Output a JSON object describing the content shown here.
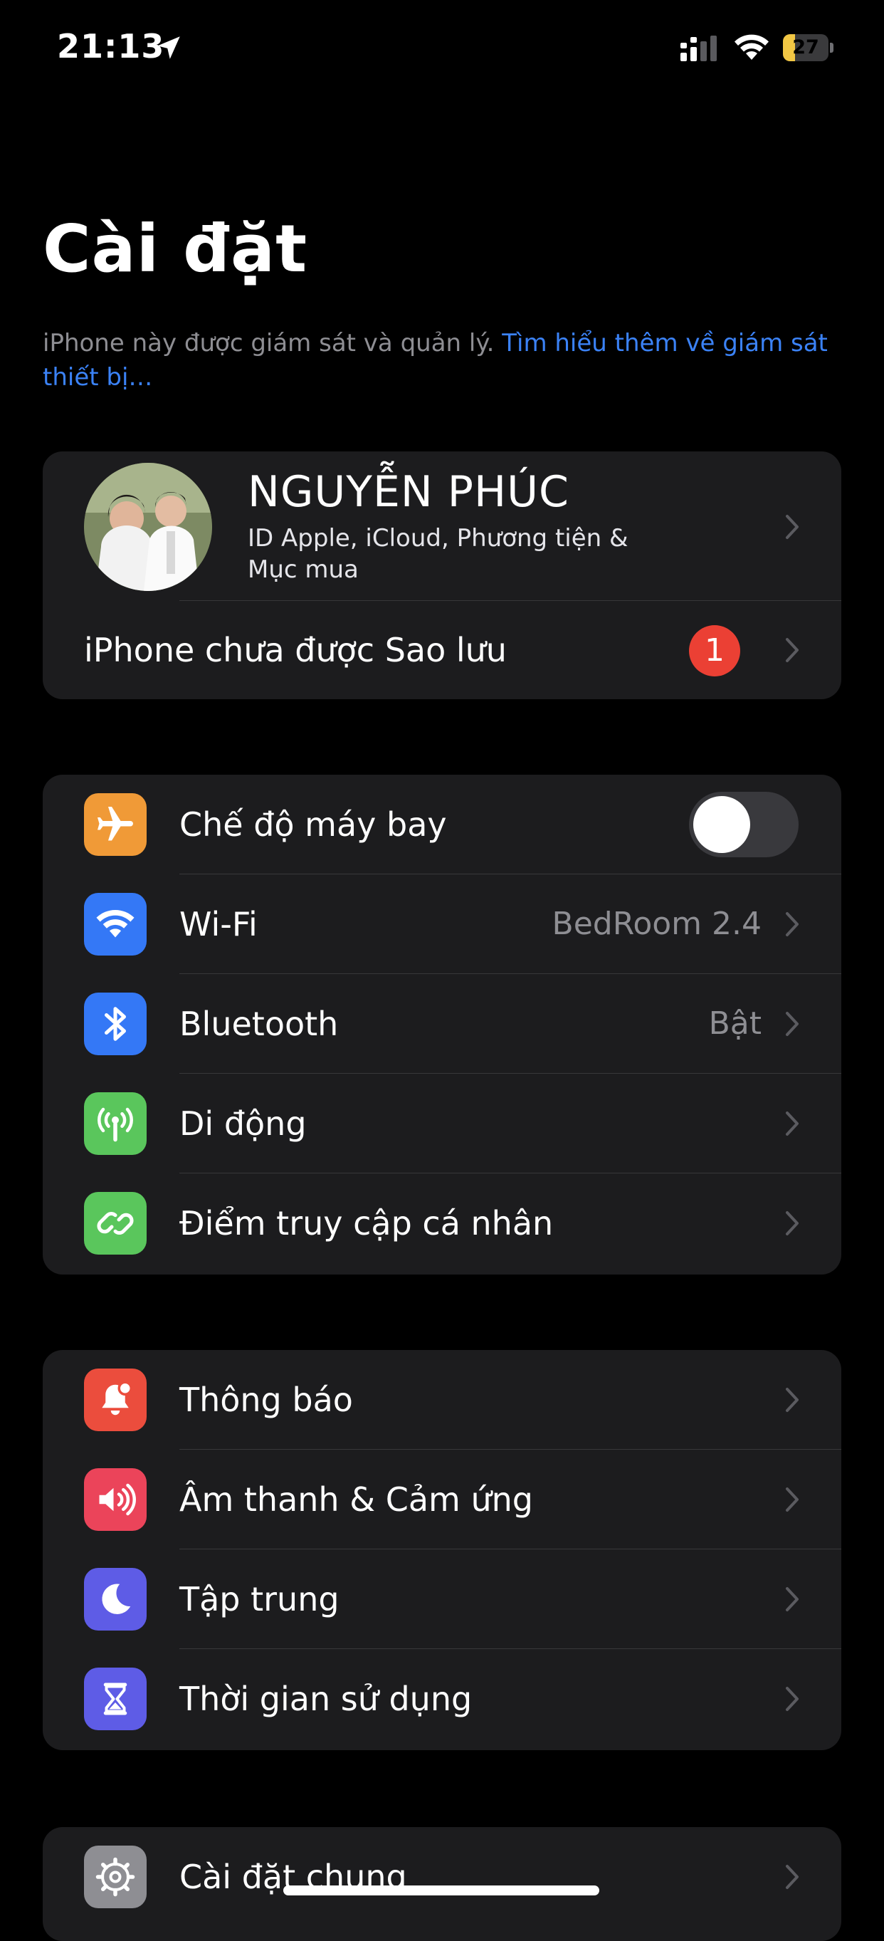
{
  "status_bar": {
    "time": "21:13",
    "battery_percent": "27",
    "battery_level": 0.27
  },
  "title": "Cài đặt",
  "supervision": {
    "text": "iPhone này được giám sát và quản lý. ",
    "link": "Tìm hiểu thêm về giám sát thiết bị…"
  },
  "profile": {
    "name": "NGUYỄN PHÚC",
    "subtitle": "ID Apple, iCloud, Phương tiện & Mục mua",
    "backup_label": "iPhone chưa được Sao lưu",
    "backup_badge": "1"
  },
  "connectivity": [
    {
      "label": "Chế độ máy bay",
      "icon": "airplane-icon",
      "color": "#f09a37",
      "toggle": false
    },
    {
      "label": "Wi-Fi",
      "value": "BedRoom 2.4",
      "icon": "wifi-icon",
      "color": "#3478f6"
    },
    {
      "label": "Bluetooth",
      "value": "Bật",
      "icon": "bluetooth-icon",
      "color": "#3478f6"
    },
    {
      "label": "Di động",
      "icon": "cellular-antenna-icon",
      "color": "#5ac65c"
    },
    {
      "label": "Điểm truy cập cá nhân",
      "icon": "hotspot-icon",
      "color": "#5ac65c"
    }
  ],
  "notifications": [
    {
      "label": "Thông báo",
      "icon": "bell-icon",
      "color": "#eb4d3d"
    },
    {
      "label": "Âm thanh & Cảm ứng",
      "icon": "speaker-icon",
      "color": "#eb445a"
    },
    {
      "label": "Tập trung",
      "icon": "moon-icon",
      "color": "#5e5ce6"
    },
    {
      "label": "Thời gian sử dụng",
      "icon": "hourglass-icon",
      "color": "#5e5ce6"
    }
  ],
  "general": [
    {
      "label": "Cài đặt chung",
      "icon": "gear-icon",
      "color": "#8e8e93"
    }
  ]
}
